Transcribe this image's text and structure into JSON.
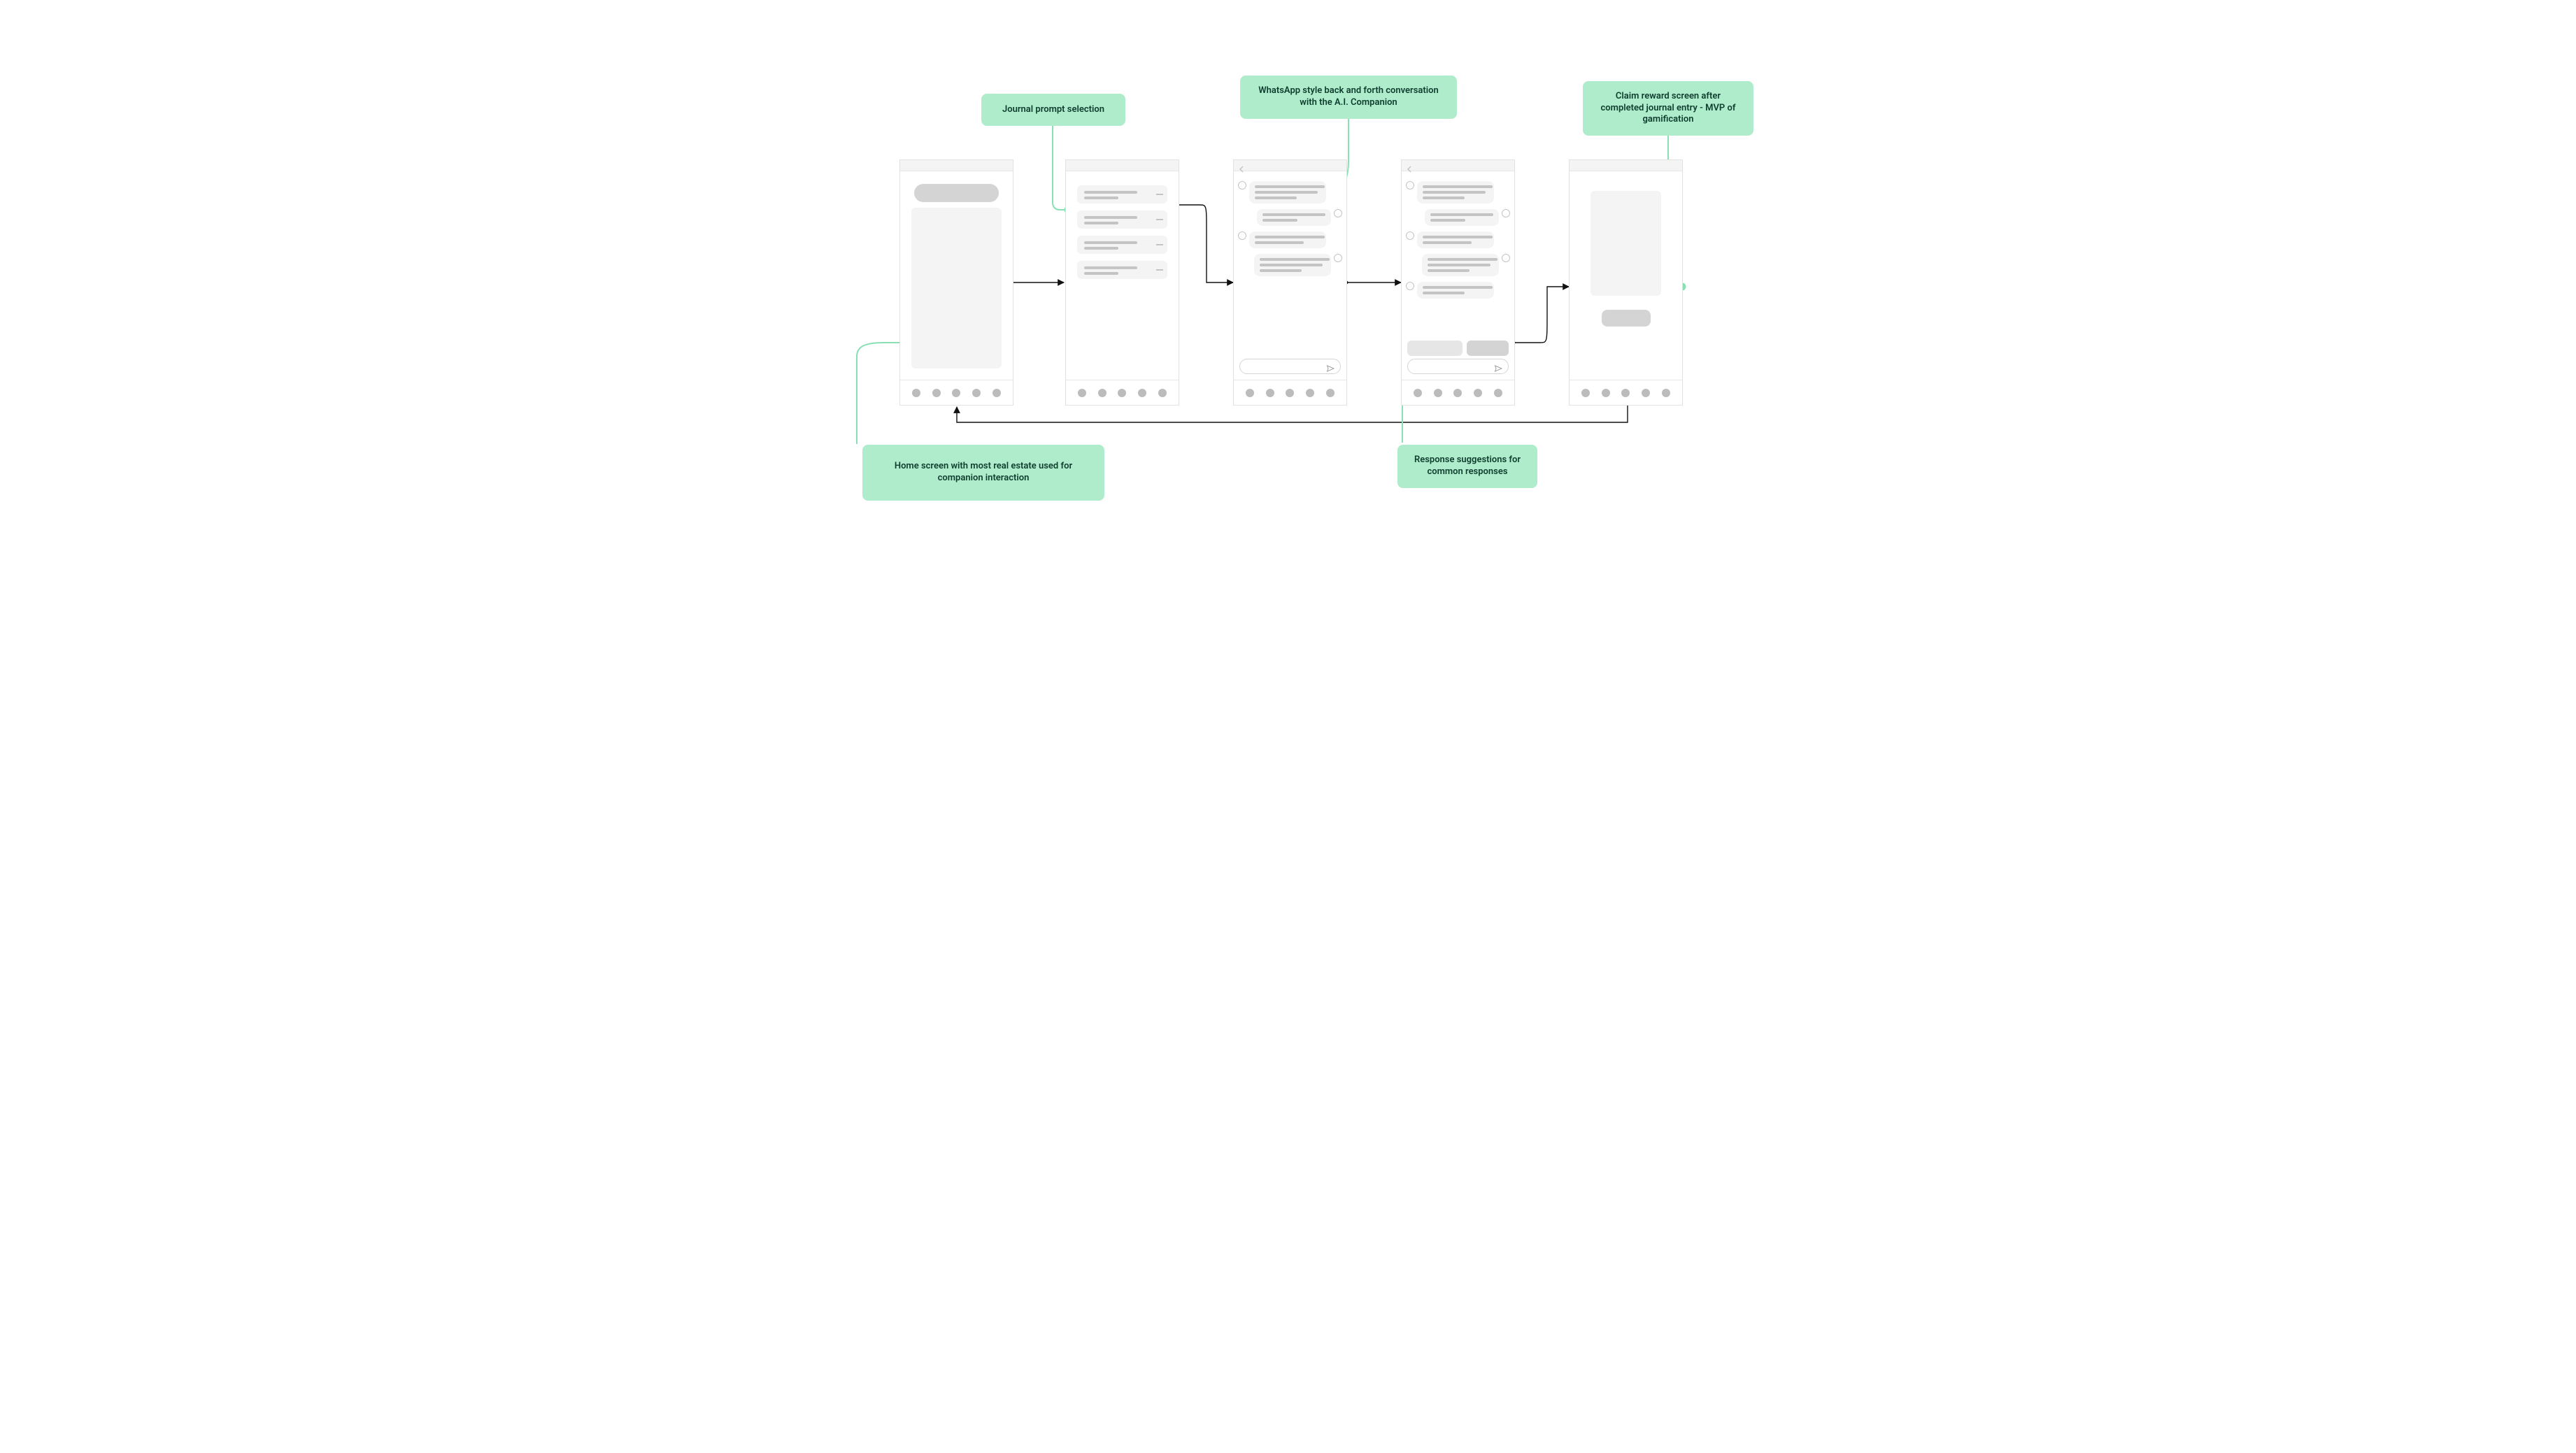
{
  "labels": {
    "journal_prompt": "Journal prompt selection",
    "chat_style": "WhatsApp style back and forth conversation with the A.I. Companion",
    "claim_reward": "Claim reward screen after completed journal entry - MVP of gamification",
    "home": "Home screen with most real estate used for companion interaction",
    "suggestions": "Response suggestions for common responses"
  },
  "screens": [
    {
      "id": "home",
      "title": "Home",
      "nav_items": 5
    },
    {
      "id": "prompt",
      "title": "Journal prompt selection",
      "nav_items": 5,
      "prompt_count": 4
    },
    {
      "id": "chat1",
      "title": "Chat",
      "nav_items": 5,
      "has_back": true,
      "has_input": true,
      "messages": [
        {
          "side": "left",
          "lines": 3
        },
        {
          "side": "right",
          "lines": 2
        },
        {
          "side": "left",
          "lines": 2
        },
        {
          "side": "right",
          "lines": 3
        }
      ]
    },
    {
      "id": "chat2",
      "title": "Chat with suggestions",
      "nav_items": 5,
      "has_back": true,
      "has_input": true,
      "has_suggestions": true,
      "messages": [
        {
          "side": "left",
          "lines": 3
        },
        {
          "side": "right",
          "lines": 2
        },
        {
          "side": "left",
          "lines": 2
        },
        {
          "side": "right",
          "lines": 3
        },
        {
          "side": "left",
          "lines": 2
        }
      ]
    },
    {
      "id": "reward",
      "title": "Claim reward",
      "nav_items": 5
    }
  ],
  "flow": [
    {
      "from": "home",
      "to": "prompt"
    },
    {
      "from": "prompt",
      "to": "chat1"
    },
    {
      "from": "chat1",
      "to": "chat2"
    },
    {
      "from": "chat2",
      "to": "reward"
    },
    {
      "from": "reward",
      "to": "home",
      "note": "loop back"
    }
  ]
}
